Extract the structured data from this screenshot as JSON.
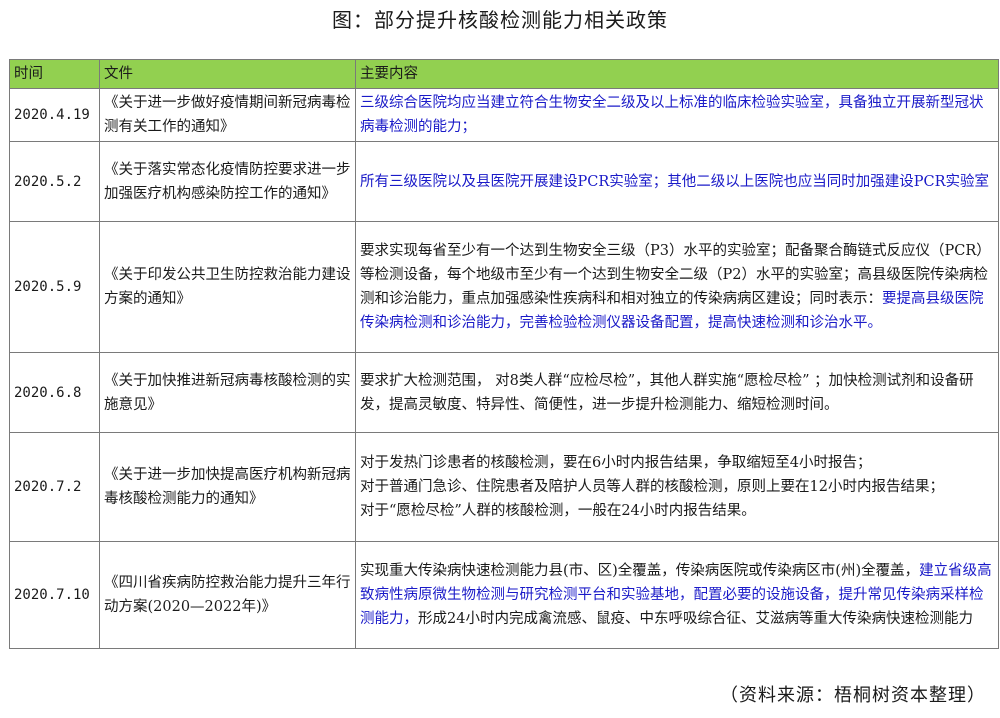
{
  "title": "图：部分提升核酸检测能力相关政策",
  "table": {
    "headers": [
      "时间",
      "文件",
      "主要内容"
    ],
    "header_color": "#92d050",
    "highlight_color": "#1a1ac8",
    "rows": [
      {
        "date": "2020.4.19",
        "doc": "《关于进一步做好疫情期间新冠病毒检测有关工作的通知》",
        "segments": [
          {
            "text": "三级综合医院均应当建立符合生物安全二级及以上标准的临床检验实验室，具备独立开展新型冠状病毒检测的能力；",
            "highlight": true
          }
        ]
      },
      {
        "date": "2020.5.2",
        "doc": "《关于落实常态化疫情防控要求进一步加强医疗机构感染防控工作的通知》",
        "segments": [
          {
            "text": "所有三级医院以及县医院开展建设PCR实验室；其他二级以上医院也应当同时加强建设PCR实验室",
            "highlight": true
          }
        ]
      },
      {
        "date": "2020.5.9",
        "doc": "《关于印发公共卫生防控救治能力建设方案的通知》",
        "segments": [
          {
            "text": "要求实现每省至少有一个达到生物安全三级（P3）水平的实验室；配备聚合酶链式反应仪（PCR）等检测设备，每个地级市至少有一个达到生物安全二级（P2）水平的实验室；高县级医院传染病检测和诊治能力，重点加强感染性疾病科和相对独立的传染病病区建设；同时表示：",
            "highlight": false
          },
          {
            "text": "要提高县级医院传染病检测和诊治能力，完善检验检测仪器设备配置，提高快速检测和诊治水平。",
            "highlight": true
          }
        ]
      },
      {
        "date": "2020.6.8",
        "doc": "《关于加快推进新冠病毒核酸检测的实施意见》",
        "segments": [
          {
            "text": "要求扩大检测范围， 对8类人群“应检尽检”，其他人群实施“愿检尽检” ；加快检测试剂和设备研发，提高灵敏度、特异性、简便性，进一步提升检测能力、缩短检测时间。",
            "highlight": false
          }
        ]
      },
      {
        "date": "2020.7.2",
        "doc": "《关于进一步加快提高医疗机构新冠病毒核酸检测能力的通知》",
        "lines": [
          "对于发热门诊患者的核酸检测，要在6小时内报告结果，争取缩短至4小时报告；",
          "对于普通门急诊、住院患者及陪护人员等人群的核酸检测，原则上要在12小时内报告结果；",
          "对于“愿检尽检”人群的核酸检测，一般在24小时内报告结果。"
        ]
      },
      {
        "date": "2020.7.10",
        "doc": "《四川省疾病防控救治能力提升三年行动方案(2020—2022年)》",
        "segments": [
          {
            "text": "实现重大传染病快速检测能力县(市、区)全覆盖，传染病医院或传染病区市(州)全覆盖，",
            "highlight": false
          },
          {
            "text": "建立省级高致病性病原微生物检测与研究检测平台和实验基地，配置必要的设施设备，提升常见传染病采样检测能力，",
            "highlight": true
          },
          {
            "text": "形成24小时内完成禽流感、鼠疫、中东呼吸综合征、艾滋病等重大传染病快速检测能力",
            "highlight": false
          }
        ]
      }
    ]
  },
  "source": "（资料来源：梧桐树资本整理）"
}
